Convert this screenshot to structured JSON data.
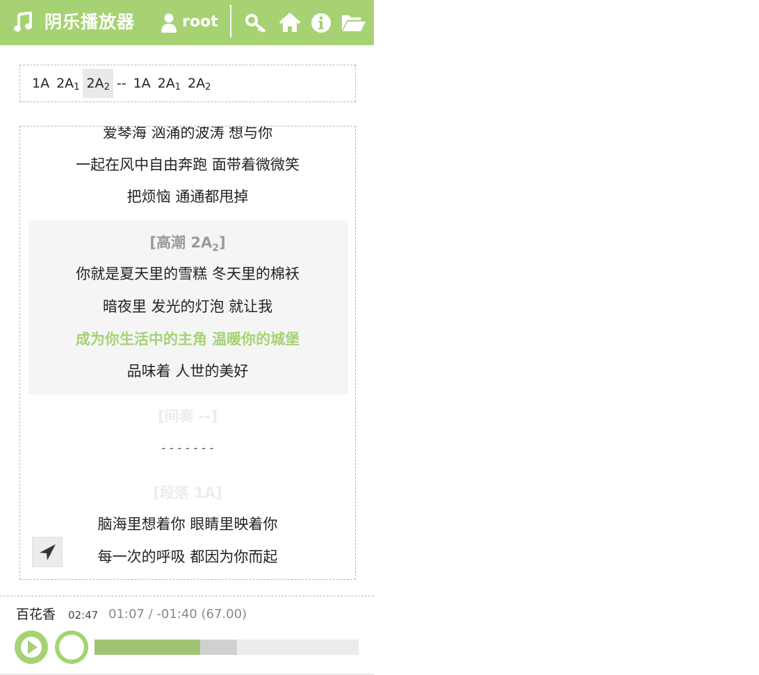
{
  "app": {
    "title": "阴乐播放器",
    "user": "root",
    "icons": [
      "music-note-icon",
      "user-icon",
      "key-icon",
      "home-icon",
      "info-icon",
      "folder-open-icon"
    ]
  },
  "colors": {
    "accent": "#a6d273",
    "progress": "#a0c475",
    "buffer": "#d0d0d0",
    "track": "#ececec"
  },
  "structure": {
    "segments": [
      {
        "base": "1A",
        "sub": ""
      },
      {
        "base": "2A",
        "sub": "1"
      },
      {
        "base": "2A",
        "sub": "2"
      },
      {
        "base": "--",
        "sub": ""
      },
      {
        "base": "1A",
        "sub": ""
      },
      {
        "base": "2A",
        "sub": "1"
      },
      {
        "base": "2A",
        "sub": "2"
      }
    ],
    "active_index": 2
  },
  "lyrics": {
    "prev_lines": [
      "爱琴海 汹涌的波涛 想与你",
      "一起在风中自由奔跑 面带着微微笑",
      "把烦恼 通通都甩掉"
    ],
    "current_section": {
      "label": "[高潮 2A",
      "sub": "2",
      "close": "]"
    },
    "current_lines": [
      "你就是夏天里的雪糕 冬天里的棉袄",
      "暗夜里 发光的灯泡 就让我",
      "成为你生活中的主角 温暖你的城堡",
      "品味着 人世的美好"
    ],
    "current_line_index": 2,
    "interlude_label": "[间奏 --]",
    "interlude_line": "- - - - - - -",
    "next_section_label": "[段落 1A]",
    "next_lines": [
      "脑海里想着你 眼睛里映着你",
      "每一次的呼吸 都因为你而起"
    ]
  },
  "player": {
    "song": "百花香",
    "duration": "02:47",
    "progress_text": "01:07 / -01:40 (67.00)",
    "progress_fraction": 0.4,
    "buffer_fraction": 0.54
  }
}
